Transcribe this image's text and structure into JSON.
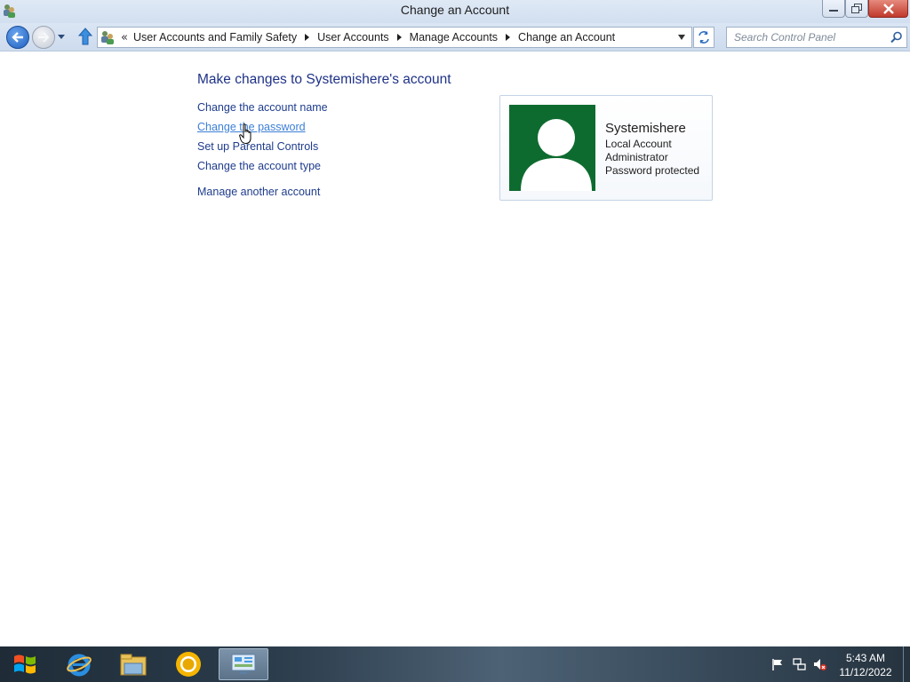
{
  "window": {
    "title": "Change an Account"
  },
  "address_bar": {
    "overflow_chevron": "«",
    "breadcrumbs": [
      "User Accounts and Family Safety",
      "User Accounts",
      "Manage Accounts",
      "Change an Account"
    ]
  },
  "search": {
    "placeholder": "Search Control Panel"
  },
  "main": {
    "heading": "Make changes to Systemishere's account",
    "tasks": [
      {
        "label": "Change the account name"
      },
      {
        "label": "Change the password"
      },
      {
        "label": "Set up Parental Controls"
      },
      {
        "label": "Change the account type"
      },
      {
        "label": "Manage another account"
      }
    ]
  },
  "account_card": {
    "name": "Systemishere",
    "type": "Local Account",
    "role": "Administrator",
    "status": "Password protected",
    "avatar_color": "#0e6b2f"
  },
  "taskbar": {
    "items": [
      "start-icon",
      "internet-explorer-icon",
      "file-explorer-icon",
      "chrome-icon",
      "control-panel-icon"
    ],
    "tray": [
      "action-center-flag-icon",
      "network-icon",
      "volume-muted-icon"
    ],
    "time": "5:43 AM",
    "date": "11/12/2022"
  },
  "colors": {
    "link": "#1e3c8c",
    "link_hover": "#3c7fd6",
    "heading": "#1e3287"
  }
}
